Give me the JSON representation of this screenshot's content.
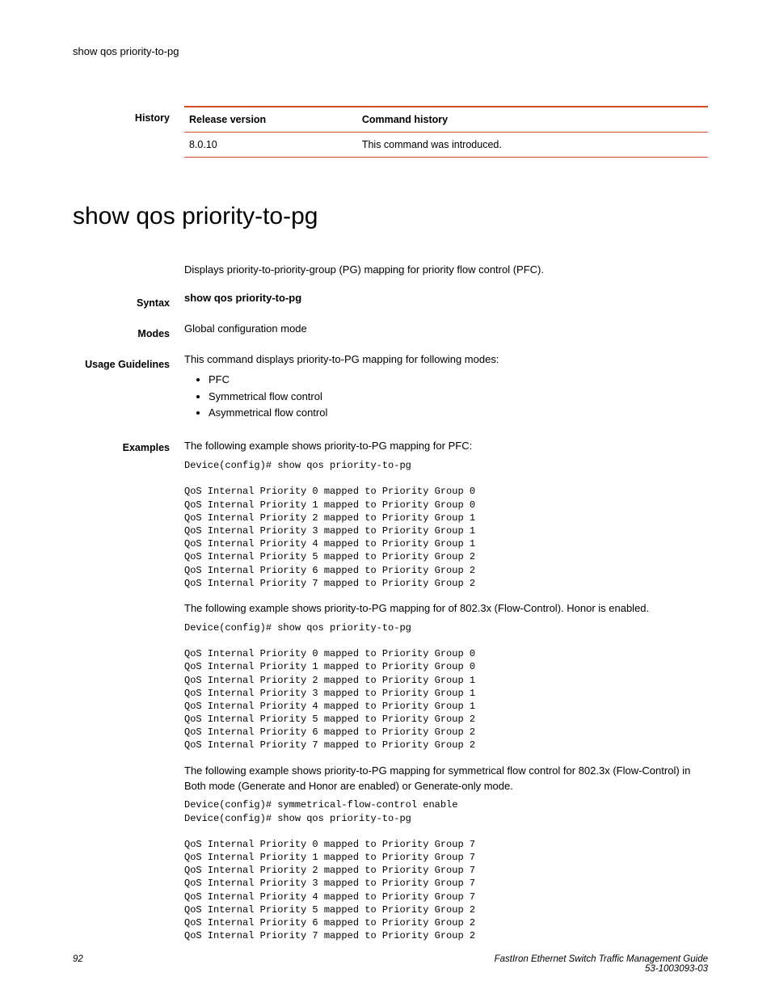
{
  "header": {
    "text": "show qos priority-to-pg"
  },
  "history": {
    "label": "History",
    "release_header": "Release version",
    "command_header": "Command history",
    "row": {
      "release": "8.0.10",
      "desc": "This command was introduced."
    }
  },
  "title": "show qos priority-to-pg",
  "summary": "Displays priority-to-priority-group (PG) mapping for priority flow control (PFC).",
  "syntax": {
    "label": "Syntax",
    "text": "show qos priority-to-pg"
  },
  "modes": {
    "label": "Modes",
    "text": "Global configuration mode"
  },
  "guidelines": {
    "label": "Usage Guidelines",
    "intro": "This command displays priority-to-PG mapping for following modes:",
    "items": {
      "a": "PFC",
      "b": "Symmetrical flow control",
      "c": "Asymmetrical flow control"
    }
  },
  "examples": {
    "label": "Examples",
    "p1": "The following example shows priority-to-PG mapping for PFC:",
    "code1": "Device(config)# show qos priority-to-pg\n\nQoS Internal Priority 0 mapped to Priority Group 0\nQoS Internal Priority 1 mapped to Priority Group 0\nQoS Internal Priority 2 mapped to Priority Group 1\nQoS Internal Priority 3 mapped to Priority Group 1\nQoS Internal Priority 4 mapped to Priority Group 1\nQoS Internal Priority 5 mapped to Priority Group 2\nQoS Internal Priority 6 mapped to Priority Group 2\nQoS Internal Priority 7 mapped to Priority Group 2",
    "p2": "The following example shows priority-to-PG mapping for of 802.3x (Flow-Control). Honor is enabled.",
    "code2": "Device(config)# show qos priority-to-pg\n\nQoS Internal Priority 0 mapped to Priority Group 0\nQoS Internal Priority 1 mapped to Priority Group 0\nQoS Internal Priority 2 mapped to Priority Group 1\nQoS Internal Priority 3 mapped to Priority Group 1\nQoS Internal Priority 4 mapped to Priority Group 1\nQoS Internal Priority 5 mapped to Priority Group 2\nQoS Internal Priority 6 mapped to Priority Group 2\nQoS Internal Priority 7 mapped to Priority Group 2",
    "p3": "The following example shows priority-to-PG mapping for symmetrical flow control for 802.3x (Flow-Control) in Both mode (Generate and Honor are enabled) or Generate-only mode.",
    "code3": "Device(config)# symmetrical-flow-control enable\nDevice(config)# show qos priority-to-pg\n\nQoS Internal Priority 0 mapped to Priority Group 7\nQoS Internal Priority 1 mapped to Priority Group 7\nQoS Internal Priority 2 mapped to Priority Group 7\nQoS Internal Priority 3 mapped to Priority Group 7\nQoS Internal Priority 4 mapped to Priority Group 7\nQoS Internal Priority 5 mapped to Priority Group 2\nQoS Internal Priority 6 mapped to Priority Group 2\nQoS Internal Priority 7 mapped to Priority Group 2"
  },
  "footer": {
    "page": "92",
    "guide": "FastIron Ethernet Switch Traffic Management Guide",
    "docnum": "53-1003093-03"
  }
}
